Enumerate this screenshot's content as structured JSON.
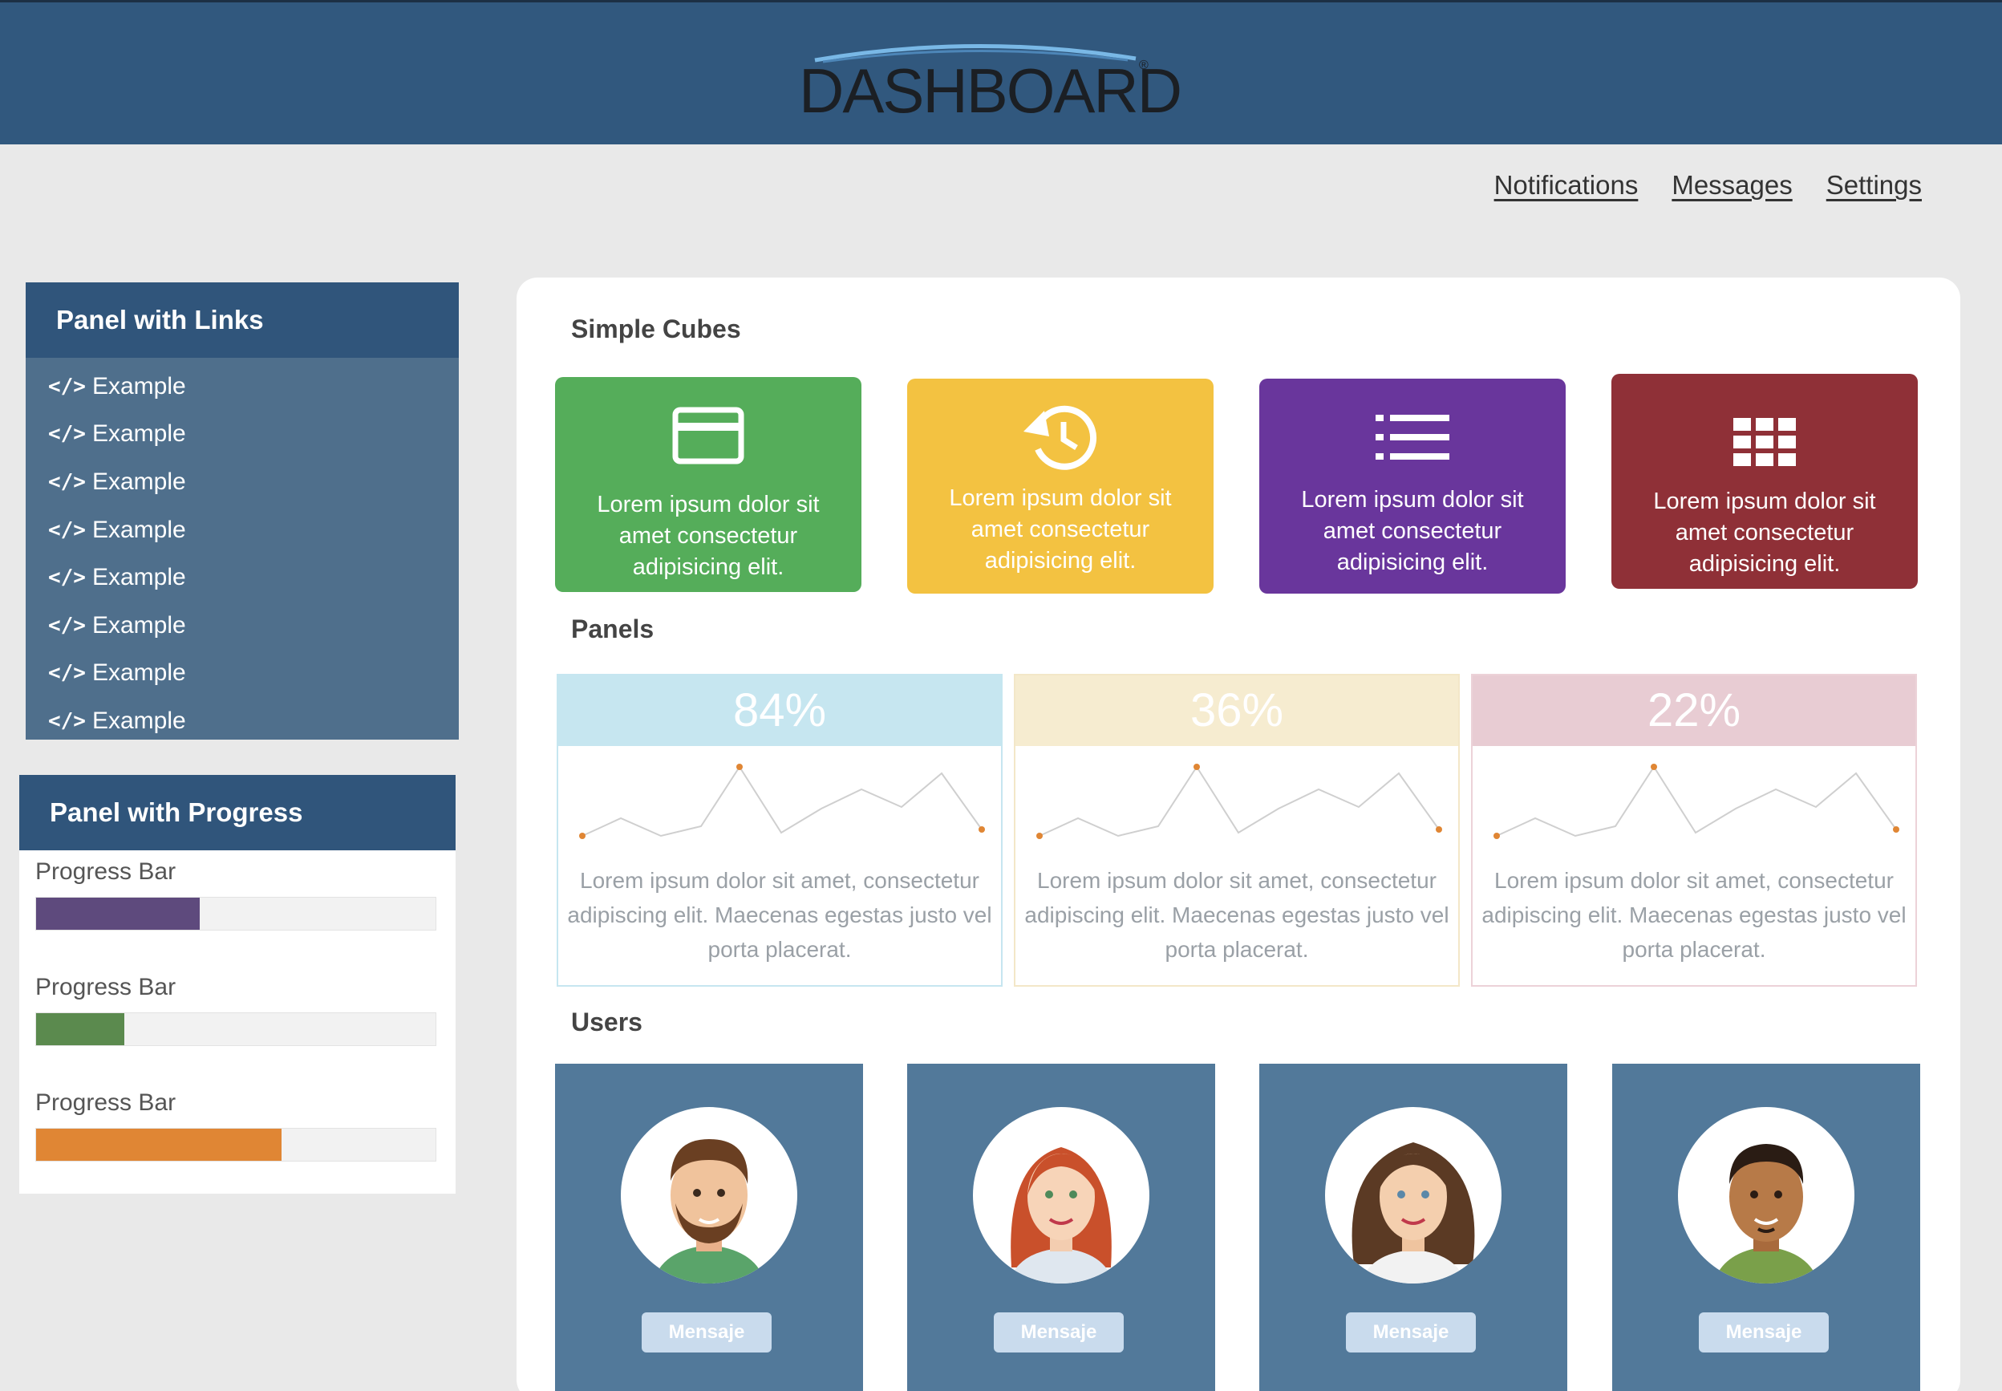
{
  "header": {
    "logo_text": "DASHBOARD",
    "logo_mark": "®"
  },
  "nav": {
    "items": [
      "Notifications",
      "Messages",
      "Settings"
    ]
  },
  "panel_links": {
    "title": "Panel with Links",
    "items": [
      "Example",
      "Example",
      "Example",
      "Example",
      "Example",
      "Example",
      "Example",
      "Example"
    ],
    "icon": "code-icon"
  },
  "panel_progress": {
    "title": "Panel with Progress",
    "bars": [
      {
        "label": "Progress Bar",
        "value": 0.41,
        "color": "#5e4a7d"
      },
      {
        "label": "Progress Bar",
        "value": 0.22,
        "color": "#5b8a4e"
      },
      {
        "label": "Progress Bar",
        "value": 0.615,
        "color": "#e08634"
      }
    ]
  },
  "main": {
    "sections": {
      "cubes": "Simple Cubes",
      "panels": "Panels",
      "users": "Users"
    },
    "cubes": [
      {
        "icon": "credit-card-icon",
        "text": "Lorem ipsum dolor sit amet consectetur adipisicing elit.",
        "color": "#55ad5a"
      },
      {
        "icon": "history-icon",
        "text": "Lorem ipsum dolor sit amet consectetur adipisicing elit.",
        "color": "#f3c241"
      },
      {
        "icon": "list-icon",
        "text": "Lorem ipsum dolor sit amet consectetur adipisicing elit.",
        "color": "#69369c"
      },
      {
        "icon": "grid-icon",
        "text": "Lorem ipsum dolor sit amet consectetur adipisicing elit.",
        "color": "#8f3037"
      }
    ],
    "panels": [
      {
        "value": "84%",
        "text": "Lorem ipsum dolor sit amet, consectetur adipiscing elit. Maecenas egestas justo vel porta placerat.",
        "head_color": "#c6e6f0",
        "border_color": "#c6e6f0"
      },
      {
        "value": "36%",
        "text": "Lorem ipsum dolor sit amet, consectetur adipiscing elit. Maecenas egestas justo vel porta placerat.",
        "head_color": "#f6ecd0",
        "border_color": "#f3e7c8"
      },
      {
        "value": "22%",
        "text": "Lorem ipsum dolor sit amet, consectetur adipiscing elit. Maecenas egestas justo vel porta placerat.",
        "head_color": "#e8ccd3",
        "border_color": "#ecd2d8"
      }
    ],
    "users": [
      {
        "avatar": "man-beard-avatar",
        "button": "Mensaje"
      },
      {
        "avatar": "woman-redhair-avatar",
        "button": "Mensaje"
      },
      {
        "avatar": "woman-curly-avatar",
        "button": "Mensaje"
      },
      {
        "avatar": "man-dark-avatar",
        "button": "Mensaje"
      }
    ]
  }
}
